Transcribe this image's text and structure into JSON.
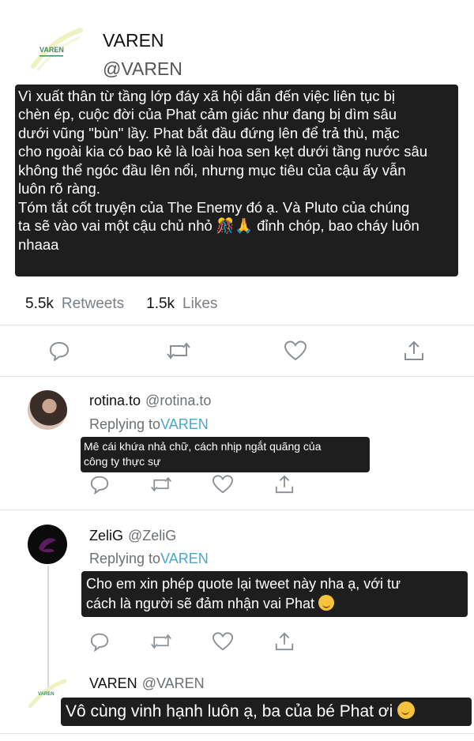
{
  "main_tweet": {
    "logo_text": "VAREN",
    "name": "VAREN",
    "handle": "@VAREN",
    "caption": "Vì xuất thân từ tầng lớp đáy xã hội dẫn đến việc liên tục bị\nchèn ép, cuộc đời của Phat cảm giác như đang bị dìm sâu\ndưới vũng \"bùn\" lầy. Phat bắt đầu đứng lên để trả thù, mặc\ncho ngoài kia có bao kẻ là loài hoa sen kẹt dưới tầng nước sâu\nkhông thể ngóc đầu lên nổi, nhưng mục tiêu của cậu ấy vẫn\nluôn rõ ràng.\nTóm tắt cốt truyện của The Enemy đó ạ. Và Pluto của chúng\nta sẽ vào vai một cậu chủ nhỏ 🎊🙏 đỉnh chóp, bao cháy luôn\nnhaaa",
    "retweets_count": "5.5k",
    "retweets_label": "Retweets",
    "likes_count": "1.5k",
    "likes_label": "Likes"
  },
  "replies": [
    {
      "name": "rotina.to",
      "handle": "@rotina.to",
      "replying_prefix": "Replying to",
      "replying_to": "VAREN",
      "caption": "Mê cái khứa nhả chữ, cách nhịp ngắt quãng của\ncông ty thực sự"
    },
    {
      "name": "ZeliG",
      "handle": "@ZeliG",
      "replying_prefix": "Replying to",
      "replying_to": "VAREN",
      "caption": "Cho em xin phép quote lại tweet này nha ạ, với tư\ncách là người sẽ đảm nhận vai Phat"
    },
    {
      "name": "VAREN",
      "handle": "@VAREN",
      "logo_text": "VAREN",
      "caption": "Vô cùng vinh hạnh luôn ạ, ba của bé Phat ơi"
    }
  ],
  "icons": [
    "reply-icon",
    "retweet-icon",
    "like-icon",
    "share-icon"
  ],
  "colors": {
    "accent_link": "#4aa7cc",
    "caption_bg": "#1e1e1e",
    "logo_green": "#3a8f6a",
    "logo_stroke": "#e9efb4"
  }
}
